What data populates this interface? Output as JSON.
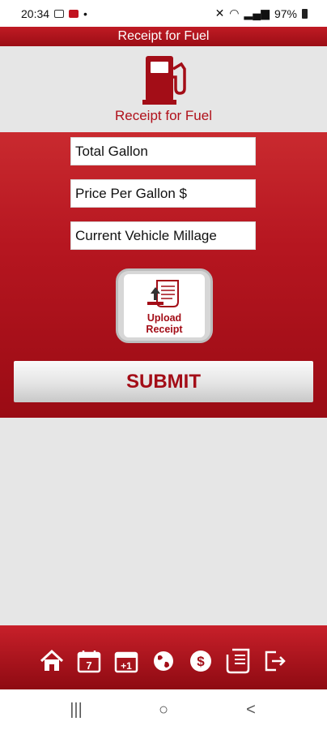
{
  "status": {
    "time": "20:34",
    "battery": "97%",
    "colors": {
      "accent": "#b0101a"
    }
  },
  "app": {
    "title": "Receipt for Fuel",
    "logo_caption": "Receipt for Fuel"
  },
  "form": {
    "total_gallon_placeholder": "Total Gallon",
    "price_per_gallon_placeholder": "Price Per Gallon $",
    "vehicle_millage_placeholder": "Current Vehicle Millage",
    "upload_label_line1": "Upload",
    "upload_label_line2": "Receipt",
    "submit_label": "SUBMIT"
  },
  "bottom_nav": {
    "items": [
      "home-icon",
      "calendar-icon",
      "plus-one-icon",
      "globe-icon",
      "dollar-icon",
      "receipt-icon",
      "logout-icon"
    ]
  },
  "system_nav": {
    "recent": "|||",
    "home": "○",
    "back": "<"
  }
}
